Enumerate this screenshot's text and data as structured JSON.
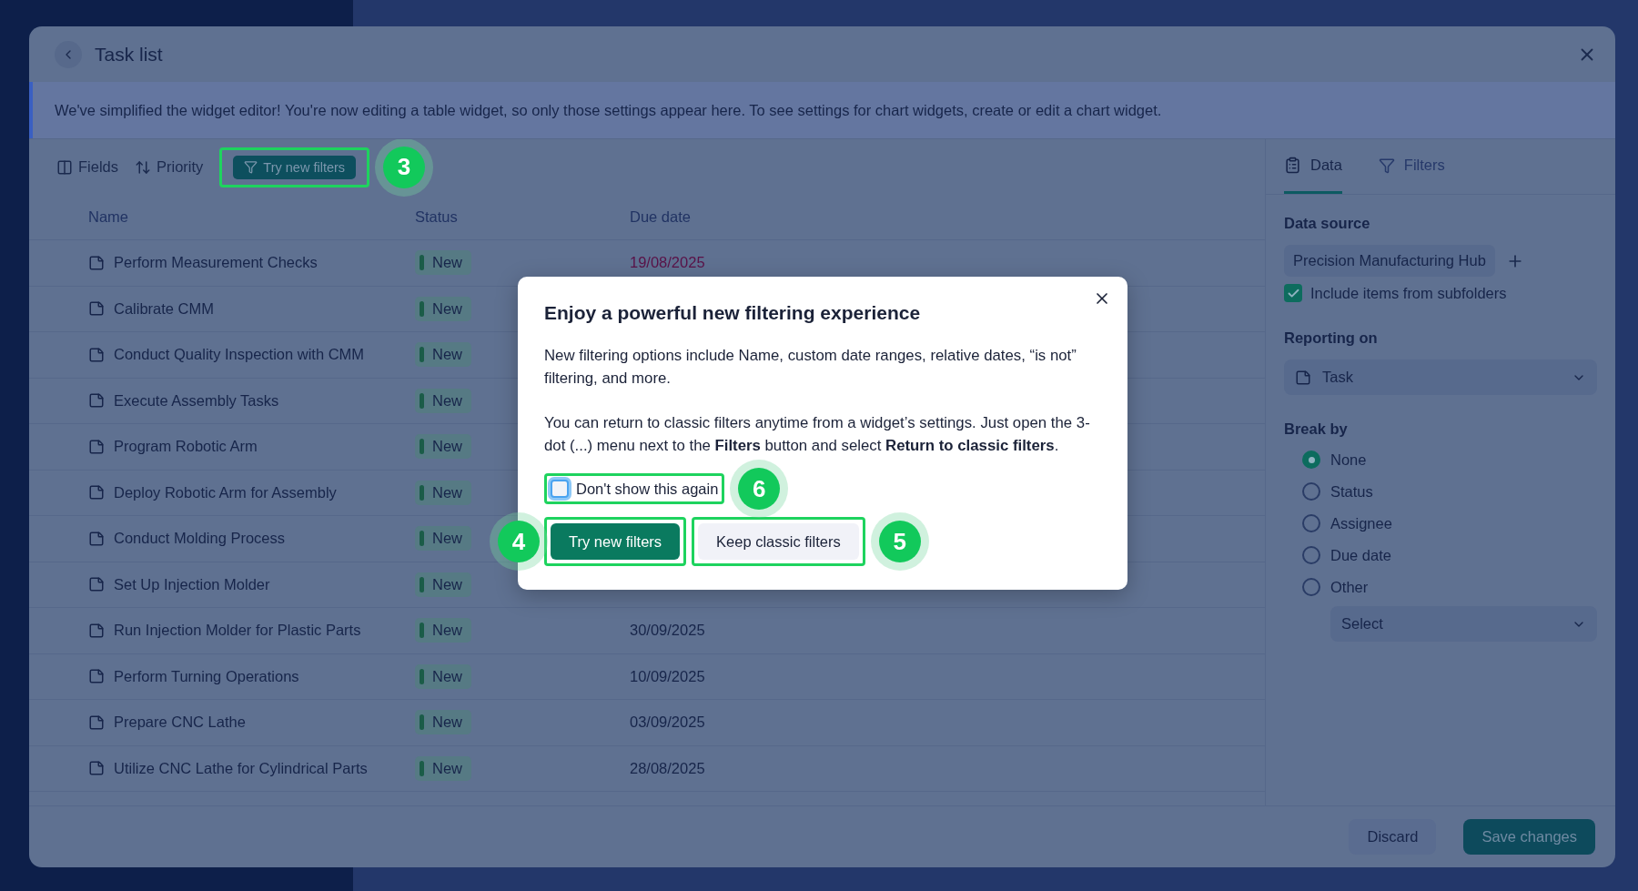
{
  "window": {
    "title": "Task list"
  },
  "banner": "We've simplified the widget editor! You're now editing a table widget, so only those settings appear here. To see settings for chart widgets, create or edit a chart widget.",
  "toolbar": [
    {
      "label": "Fields",
      "kind": "fields",
      "highlighted": false
    },
    {
      "label": "Priority",
      "kind": "sort",
      "highlighted": false
    },
    {
      "label": "Try new filters",
      "kind": "filter",
      "highlighted": true,
      "callout": "3"
    }
  ],
  "table": {
    "columns": [
      "Name",
      "Status",
      "Due date"
    ],
    "rows": [
      {
        "name": "Perform Measurement Checks",
        "status": "New",
        "due": "19/08/2025",
        "overdue": true
      },
      {
        "name": "Calibrate CMM",
        "status": "New"
      },
      {
        "name": "Conduct Quality Inspection with CMM",
        "status": "New"
      },
      {
        "name": "Execute Assembly Tasks",
        "status": "New"
      },
      {
        "name": "Program Robotic Arm",
        "status": "New"
      },
      {
        "name": "Deploy Robotic Arm for Assembly",
        "status": "New"
      },
      {
        "name": "Conduct Molding Process",
        "status": "New"
      },
      {
        "name": "Set Up Injection Molder",
        "status": "New"
      },
      {
        "name": "Run Injection Molder for Plastic Parts",
        "status": "New",
        "due": "30/09/2025",
        "overdue": false
      },
      {
        "name": "Perform Turning Operations",
        "status": "New",
        "due": "10/09/2025",
        "overdue": false
      },
      {
        "name": "Prepare CNC Lathe",
        "status": "New",
        "due": "03/09/2025",
        "overdue": false
      },
      {
        "name": "Utilize CNC Lathe for Cylindrical Parts",
        "status": "New",
        "due": "28/08/2025",
        "overdue": false
      }
    ]
  },
  "side_panel": {
    "tabs": [
      {
        "label": "Data",
        "kind": "data",
        "selected": true
      },
      {
        "label": "Filters",
        "kind": "filters",
        "selected": false
      }
    ],
    "data_source": {
      "heading": "Data source",
      "value": "Precision Manufacturing Hub",
      "include_subfolders": {
        "label": "Include items from subfolders",
        "checked": true
      }
    },
    "reporting_on": {
      "heading": "Reporting on",
      "value": "Task"
    },
    "break_by": {
      "heading": "Break by",
      "options": [
        {
          "label": "None",
          "selected": true
        },
        {
          "label": "Status",
          "selected": false
        },
        {
          "label": "Assignee",
          "selected": false
        },
        {
          "label": "Due date",
          "selected": false
        },
        {
          "label": "Other",
          "selected": false
        }
      ],
      "select": {
        "placeholder": "Select"
      }
    }
  },
  "footer": {
    "buttons": [
      {
        "label": "Discard",
        "kind": "secondary"
      },
      {
        "label": "Save changes",
        "kind": "primary"
      }
    ]
  },
  "modal": {
    "title": "Enjoy a powerful new filtering experience",
    "paragraphs": [
      "New filtering options include Name, custom date ranges, relative dates, “is not” filtering, and more.",
      "You can return to classic filters anytime from a widget’s settings. Just open the 3-dot (...) menu next to the **Filters** button and select **Return to classic filters**."
    ],
    "checkbox": {
      "label": "Don't show this again",
      "checked": false,
      "highlighted": true,
      "callout": "6"
    },
    "buttons": [
      {
        "label": "Try new filters",
        "kind": "primary",
        "highlighted": true,
        "callout": "4"
      },
      {
        "label": "Keep classic filters",
        "kind": "secondary",
        "highlighted": true,
        "callout": "5"
      }
    ]
  }
}
